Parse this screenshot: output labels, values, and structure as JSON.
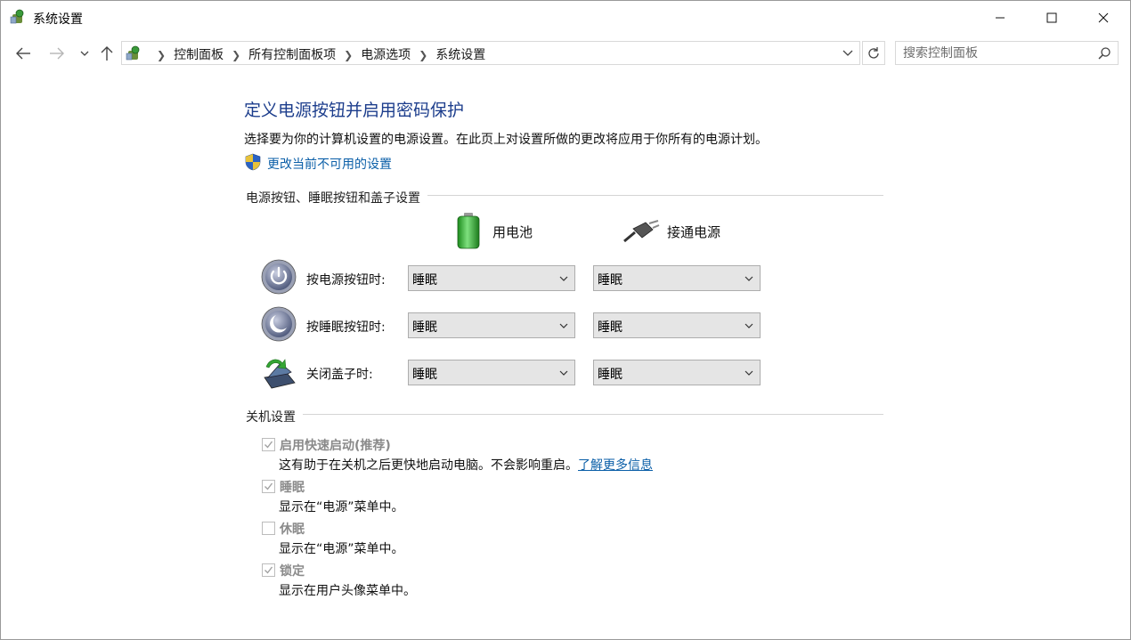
{
  "window": {
    "title": "系统设置",
    "minimize_label": "minimize",
    "maximize_label": "maximize",
    "close_label": "close"
  },
  "navigation": {
    "breadcrumbs": [
      "控制面板",
      "所有控制面板项",
      "电源选项",
      "系统设置"
    ],
    "search_placeholder": "搜索控制面板"
  },
  "page": {
    "heading": "定义电源按钮并启用密码保护",
    "description": "选择要为你的计算机设置的电源设置。在此页上对设置所做的更改将应用于你所有的电源计划。",
    "change_settings_link": "更改当前不可用的设置"
  },
  "buttons_section": {
    "label": "电源按钮、睡眠按钮和盖子设置",
    "battery_header": "用电池",
    "plugged_header": "接通电源",
    "rows": [
      {
        "label": "按电源按钮时:",
        "battery": "睡眠",
        "plugged": "睡眠",
        "icon": "power-button-icon"
      },
      {
        "label": "按睡眠按钮时:",
        "battery": "睡眠",
        "plugged": "睡眠",
        "icon": "sleep-button-icon"
      },
      {
        "label": "关闭盖子时:",
        "battery": "睡眠",
        "plugged": "睡眠",
        "icon": "laptop-lid-icon"
      }
    ]
  },
  "shutdown_section": {
    "label": "关机设置",
    "items": [
      {
        "label": "启用快速启动(推荐)",
        "checked": true,
        "description": "这有助于在关机之后更快地启动电脑。不会影响重启。",
        "link": "了解更多信息"
      },
      {
        "label": "睡眠",
        "checked": true,
        "description": "显示在“电源”菜单中。"
      },
      {
        "label": "休眠",
        "checked": false,
        "description": "显示在“电源”菜单中。"
      },
      {
        "label": "锁定",
        "checked": true,
        "description": "显示在用户头像菜单中。"
      }
    ]
  },
  "colors": {
    "heading": "#1c3d8c",
    "link": "#0b5fa8",
    "disabled_text": "#8a8a8a",
    "select_bg": "#e5e5e5"
  }
}
